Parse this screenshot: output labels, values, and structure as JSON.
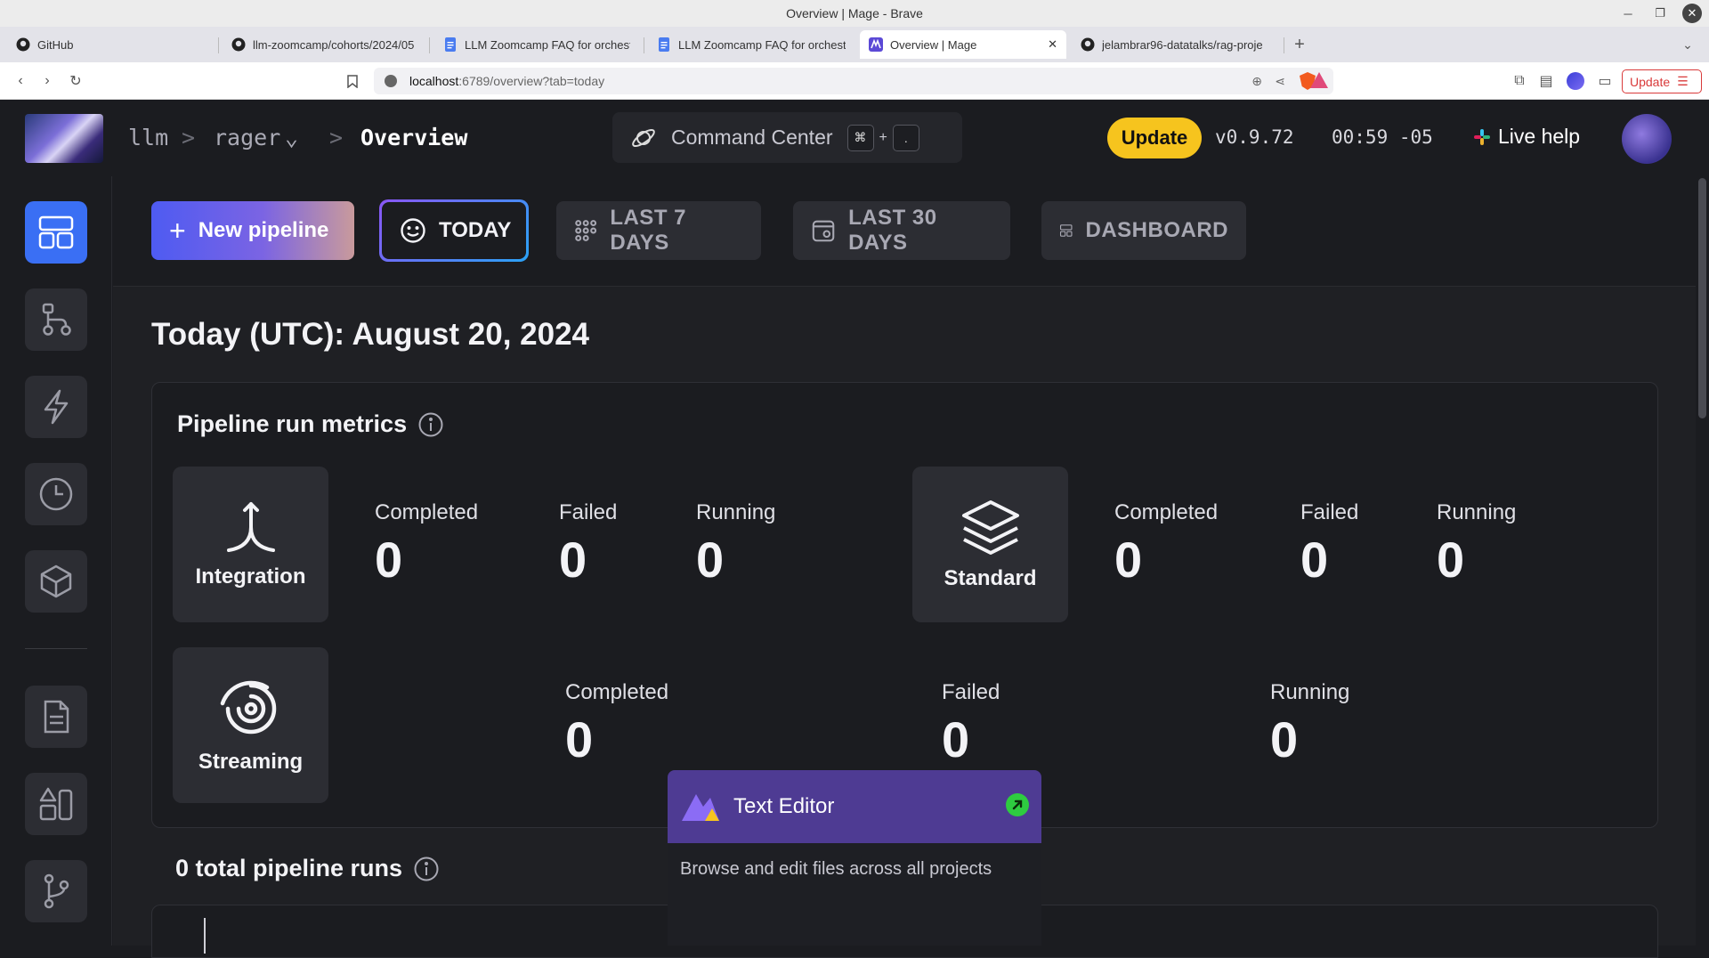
{
  "window": {
    "title": "Overview | Mage - Brave"
  },
  "tabs": [
    {
      "title": "GitHub",
      "icon": "github-icon"
    },
    {
      "title": "llm-zoomcamp/cohorts/2024/05",
      "icon": "github-icon"
    },
    {
      "title": "LLM Zoomcamp FAQ for orchestr",
      "icon": "docs-icon"
    },
    {
      "title": "LLM Zoomcamp FAQ for orchestr",
      "icon": "docs-icon"
    },
    {
      "title": "Overview | Mage",
      "icon": "mage-icon",
      "active": true
    },
    {
      "title": "jelambrar96-datatalks/rag-proje",
      "icon": "github-icon"
    }
  ],
  "address": {
    "host": "localhost",
    "rest": ":6789/overview?tab=today"
  },
  "browser": {
    "update_label": "Update"
  },
  "header": {
    "crumbs": [
      "llm",
      ">",
      "rager",
      ">",
      "Overview"
    ],
    "command_center": "Command Center",
    "shortcut_cmd": "⌘",
    "shortcut_plus": "+",
    "shortcut_key": ".",
    "update_label": "Update",
    "version": "v0.9.72",
    "clock": "00:59 -05",
    "live_help": "Live help"
  },
  "toolbar": {
    "new_pipeline": "New pipeline",
    "today": "TODAY",
    "last7": "LAST 7 DAYS",
    "last30": "LAST 30 DAYS",
    "dashboard": "DASHBOARD"
  },
  "date_heading": "Today (UTC): August 20, 2024",
  "metrics": {
    "title": "Pipeline run metrics",
    "integration": {
      "label": "Integration",
      "completed_label": "Completed",
      "completed": "0",
      "failed_label": "Failed",
      "failed": "0",
      "running_label": "Running",
      "running": "0"
    },
    "standard": {
      "label": "Standard",
      "completed_label": "Completed",
      "completed": "0",
      "failed_label": "Failed",
      "failed": "0",
      "running_label": "Running",
      "running": "0"
    },
    "streaming": {
      "label": "Streaming",
      "completed_label": "Completed",
      "completed": "0",
      "failed_label": "Failed",
      "failed": "0",
      "running_label": "Running",
      "running": "0"
    }
  },
  "runs": {
    "title": "0 total pipeline runs"
  },
  "popup": {
    "title": "Text Editor",
    "description": "Browse and edit files across all projects"
  },
  "colors": {
    "accent": "#3a6ff4",
    "update": "#f6c41e",
    "popup": "#4e3b93",
    "background": "#1b1c20"
  }
}
